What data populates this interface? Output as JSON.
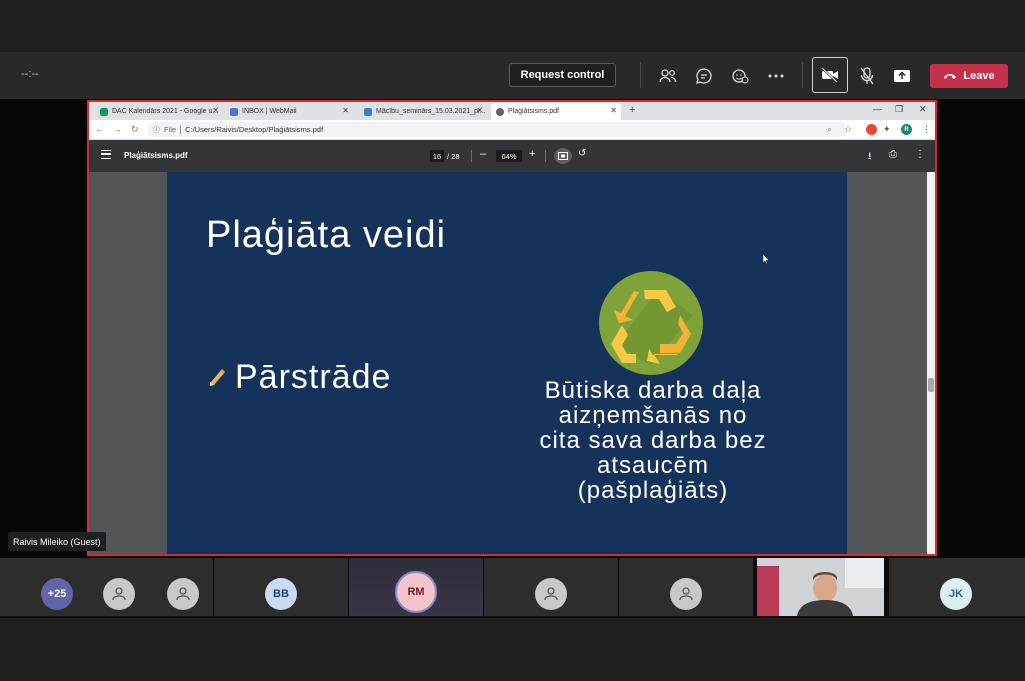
{
  "meeting": {
    "timer": "--:--",
    "request_control_label": "Request control",
    "leave_label": "Leave",
    "accent_leave": "#c4314b",
    "toolbar_icons": [
      "people-icon",
      "chat-icon",
      "reactions-icon",
      "more-icon",
      "camera-off-icon",
      "mic-off-icon",
      "share-screen-icon",
      "phone-hangup-icon"
    ]
  },
  "browser": {
    "tabs": [
      {
        "label": "DAC Kalendārs 2021 - Google u...",
        "icon": "google-sheets-icon",
        "color": "#0f9d58"
      },
      {
        "label": "INBOX | WebMail",
        "icon": "webmail-icon",
        "color": "#4a7bd0"
      },
      {
        "label": "Mācību_seminārs_15.03.2021_pr...",
        "icon": "document-icon",
        "color": "#3b82c4"
      },
      {
        "label": "Plaģiātsisms.pdf",
        "icon": "globe-icon",
        "color": "#5f6368"
      }
    ],
    "file_label": "File",
    "url": "C:/Users/Raivis/Desktop/Plaģiātsisms.pdf",
    "profile_initial": "R"
  },
  "pdf": {
    "filename": "Plaģiātsisms.pdf",
    "current_page": "16",
    "total_pages": "/ 28",
    "zoom": "64%"
  },
  "slide": {
    "title": "Plaģiāta veidi",
    "bullet": "Pārstrāde",
    "description_lines": [
      "Būtiska darba daļa",
      "aizņemšanās no",
      "cita sava darba bez",
      "atsaucēm",
      "(pašplaģiāts)"
    ],
    "background": "#14325a"
  },
  "presenter": {
    "name": "Raivis Mileiko (Guest)"
  },
  "participants": [
    {
      "type": "overflow",
      "label": "+25",
      "color": "#6264a7"
    },
    {
      "type": "generic"
    },
    {
      "type": "generic"
    },
    {
      "type": "initials",
      "label": "BB",
      "color": "#c7dcf2",
      "text_color": "#1f3f6b"
    },
    {
      "type": "initials",
      "label": "RM",
      "color": "#f2c6c8",
      "text_color": "#7a1b22",
      "speaking": true
    },
    {
      "type": "generic"
    },
    {
      "type": "generic"
    },
    {
      "type": "video"
    },
    {
      "type": "initials",
      "label": "JK",
      "color": "#dbeef2",
      "text_color": "#2a6b74"
    }
  ]
}
